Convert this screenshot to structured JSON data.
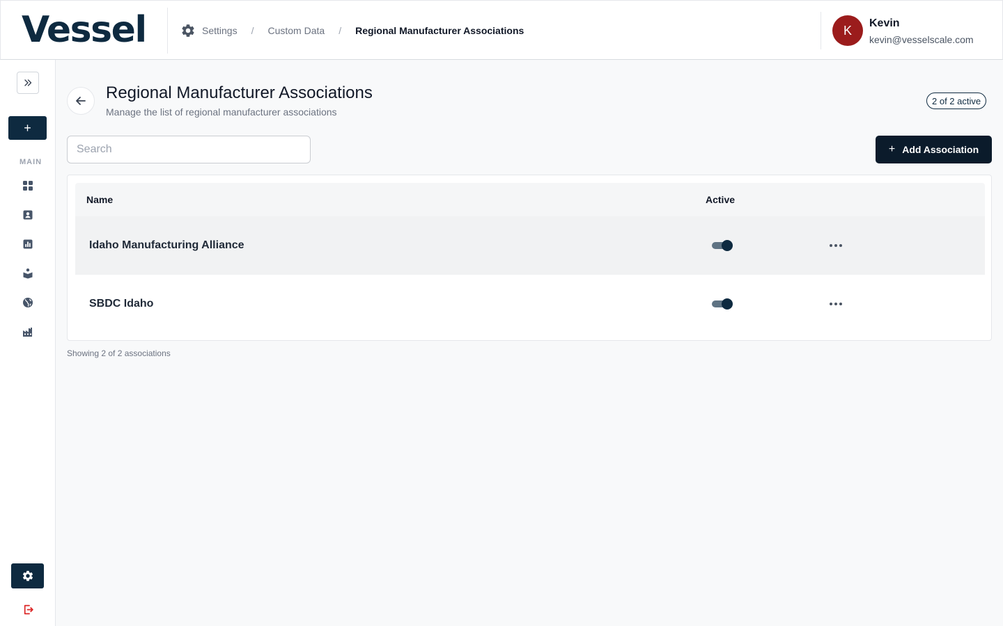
{
  "header": {
    "logo": "Vessel",
    "breadcrumb": {
      "items": [
        "Settings",
        "Custom Data"
      ],
      "current": "Regional Manufacturer Associations",
      "separator": "/"
    },
    "user": {
      "initial": "K",
      "name": "Kevin",
      "email": "kevin@vesselscale.com"
    }
  },
  "sidebar": {
    "expand_icon": "chevrons-right-icon",
    "new_label": "+",
    "section_label": "MAIN",
    "items": [
      {
        "icon": "dashboard-grid-icon"
      },
      {
        "icon": "contact-card-icon"
      },
      {
        "icon": "bar-chart-icon"
      },
      {
        "icon": "reader-icon"
      },
      {
        "icon": "globe-icon"
      },
      {
        "icon": "factory-icon"
      }
    ]
  },
  "page": {
    "title": "Regional Manufacturer Associations",
    "subtitle": "Manage the list of regional manufacturer associations",
    "active_badge": "2 of 2 active",
    "search_placeholder": "Search",
    "add_label": "Add Association",
    "add_icon": "+"
  },
  "table": {
    "columns": [
      "Name",
      "Active"
    ],
    "rows": [
      {
        "name": "Idaho Manufacturing Alliance",
        "active": true
      },
      {
        "name": "SBDC Idaho",
        "active": true
      }
    ]
  },
  "footer": {
    "count_text": "Showing 2 of 2 associations"
  },
  "colors": {
    "brand": "#0e2a40",
    "avatar": "#9b1c1c",
    "logout": "#dc2626"
  }
}
